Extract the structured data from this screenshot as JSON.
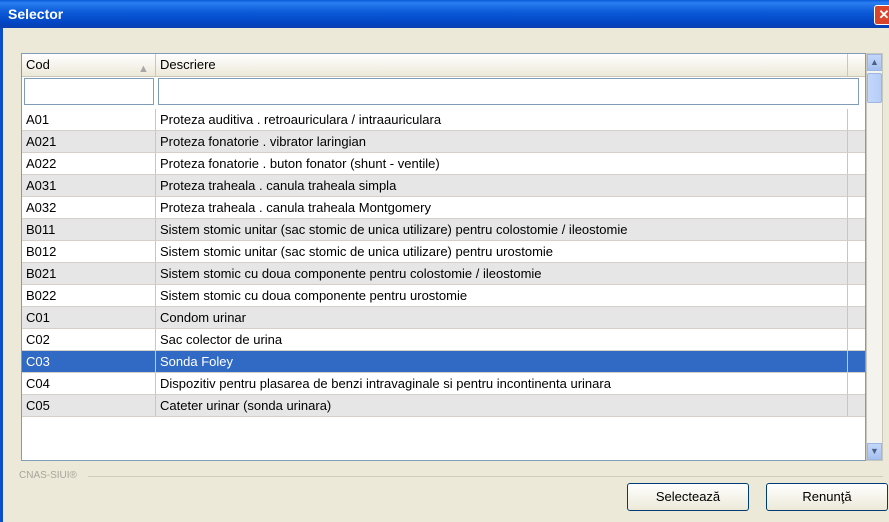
{
  "window": {
    "title": "Selector",
    "close_symbol": "✕"
  },
  "columns": {
    "cod": "Cod",
    "descriere": "Descriere",
    "sort_indicator": "▲"
  },
  "filter": {
    "cod_value": "",
    "descriere_value": ""
  },
  "rows": [
    {
      "cod": "A01",
      "descriere": "Proteza auditiva . retroauriculara / intraauriculara"
    },
    {
      "cod": "A021",
      "descriere": "Proteza fonatorie . vibrator laringian"
    },
    {
      "cod": "A022",
      "descriere": "Proteza fonatorie . buton fonator (shunt - ventile)"
    },
    {
      "cod": "A031",
      "descriere": "Proteza traheala . canula traheala simpla"
    },
    {
      "cod": "A032",
      "descriere": "Proteza traheala . canula traheala Montgomery"
    },
    {
      "cod": "B011",
      "descriere": "Sistem stomic unitar (sac stomic de unica utilizare) pentru colostomie / ileostomie"
    },
    {
      "cod": "B012",
      "descriere": "Sistem stomic unitar (sac stomic de unica utilizare) pentru urostomie"
    },
    {
      "cod": "B021",
      "descriere": "Sistem stomic cu doua componente pentru colostomie / ileostomie"
    },
    {
      "cod": "B022",
      "descriere": "Sistem stomic cu doua componente pentru urostomie"
    },
    {
      "cod": "C01",
      "descriere": "Condom urinar"
    },
    {
      "cod": "C02",
      "descriere": "Sac colector de urina"
    },
    {
      "cod": "C03",
      "descriere": "Sonda Foley"
    },
    {
      "cod": "C04",
      "descriere": "Dispozitiv pentru plasarea de benzi intravaginale si pentru incontinenta urinara"
    },
    {
      "cod": "C05",
      "descriere": "Cateter urinar (sonda urinara)"
    }
  ],
  "selected_row": "C03",
  "scrollbar": {
    "up": "▲",
    "down": "▼"
  },
  "footer": {
    "brand": "CNAS-SIUI®"
  },
  "buttons": {
    "select": "Selectează",
    "cancel": "Renunţă"
  },
  "colors": {
    "title_bar": "#0b59d7",
    "selection": "#316ac5",
    "alt_row": "#e6e6e6"
  }
}
